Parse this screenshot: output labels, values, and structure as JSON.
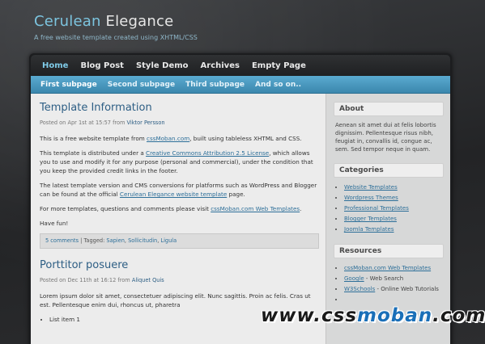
{
  "header": {
    "title_accent": "Cerulean",
    "title_rest": " Elegance",
    "tagline": "A free website template created using XHTML/CSS"
  },
  "main_nav": [
    {
      "label": "Home",
      "active": true
    },
    {
      "label": "Blog Post"
    },
    {
      "label": "Style Demo"
    },
    {
      "label": "Archives"
    },
    {
      "label": "Empty Page"
    }
  ],
  "sub_nav": [
    {
      "label": "First subpage",
      "active": true
    },
    {
      "label": "Second subpage"
    },
    {
      "label": "Third subpage"
    },
    {
      "label": "And so on.."
    }
  ],
  "post1": {
    "title": "Template Information",
    "meta_prefix": "Posted on Apr 1st at 15:57 from ",
    "author": "Viktor Persson",
    "p1_a": "This is a free website template from ",
    "p1_link": "cssMoban.com",
    "p1_b": ", built using tableless XHTML and CSS.",
    "p2_a": "This template is distributed under a ",
    "p2_link": "Creative Commons Attribution 2.5 License",
    "p2_b": ", which allows you to use and modify it for any purpose (personal and commercial), under the condition that you keep the provided credit links in the footer.",
    "p3_a": "The latest template version and CMS conversions for platforms such as WordPress and Blogger can be found at the official ",
    "p3_link": "Cerulean Elegance website template",
    "p3_b": " page.",
    "p4_a": "For more templates, questions and comments please visit ",
    "p4_link": "cssMoban.com Web Templates",
    "p4_b": ".",
    "p5": "Have fun!",
    "comments": "5 comments",
    "tagged": " | Tagged: ",
    "tag1": "Sapien",
    "tag2": "Sollicitudin",
    "tag3": "Ligula",
    "comma": ", "
  },
  "post2": {
    "title": "Porttitor posuere",
    "meta_prefix": "Posted on Dec 11th at 16:12 from ",
    "author": "Aliquet Quis",
    "p1": "Lorem ipsum dolor sit amet, consectetuer adipiscing elit. Nunc sagittis. Proin ac felis. Cras ut est. Pellentesque enim dui, rhoncus ut, pharetra",
    "list_item_1": "List item 1"
  },
  "sidebar": {
    "about_title": "About",
    "about_text": "Aenean sit amet dui at felis lobortis dignissim. Pellentesque risus nibh, feugiat in, convallis id, congue ac, sem. Sed tempor neque in quam.",
    "categories_title": "Categories",
    "categories": [
      "Website Templates",
      "Wordpress Themes",
      "Professional Templates",
      "Blogger Templates",
      "Joomla Templates"
    ],
    "resources_title": "Resources",
    "resources": [
      {
        "link": "cssMoban.com Web Templates",
        "desc": ""
      },
      {
        "link": "Google",
        "desc": " - Web Search"
      },
      {
        "link": "W3Schools",
        "desc": " - Online Web Tutorials"
      },
      {
        "link": "",
        "desc": ""
      }
    ]
  },
  "watermark": {
    "part1": "www.css",
    "part2": "moban",
    "part3": ".com"
  }
}
